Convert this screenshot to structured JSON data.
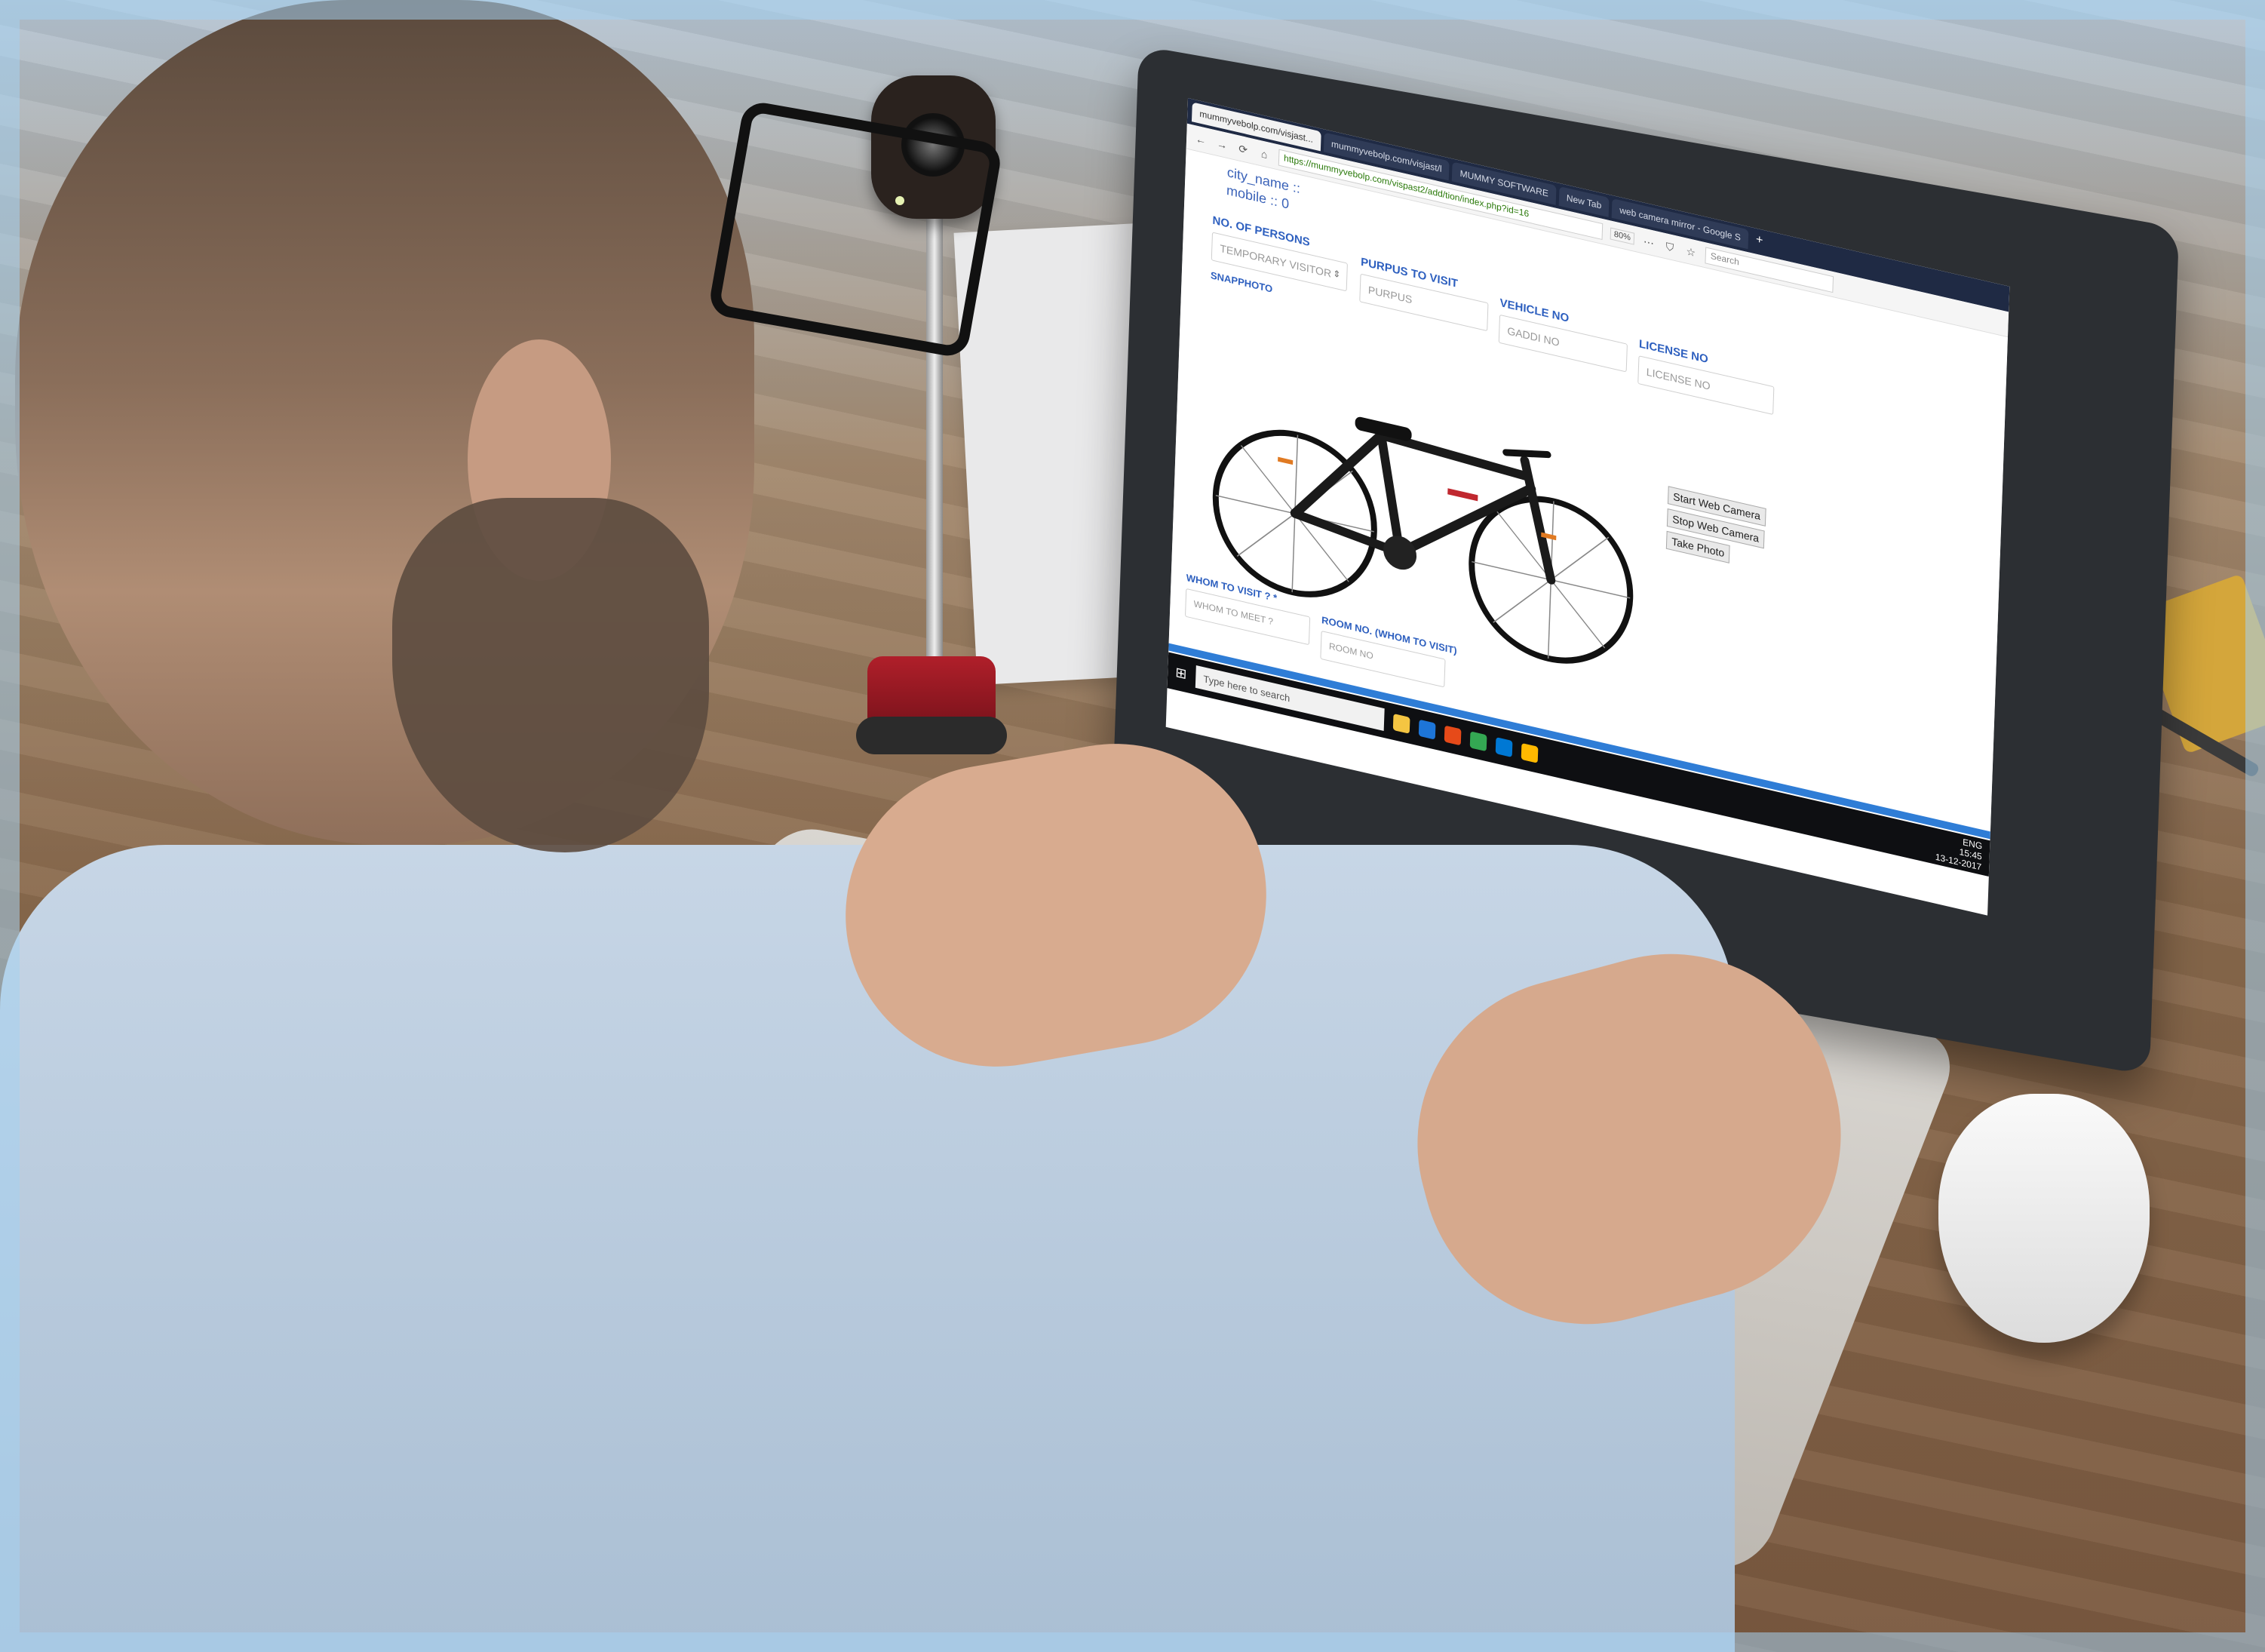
{
  "browser": {
    "tabs": [
      "mummyvebolp.com/visjast...",
      "mummyvebolp.com/visjast/l",
      "MUMMY SOFTWARE",
      "New Tab",
      "web camera mirror - Google S"
    ],
    "tab_add": "+",
    "url": "https://mummyvebolp.com/vispast2/add/tion/index.php?id=16",
    "zoom": "80%",
    "search_placeholder": "Search"
  },
  "form": {
    "prev_fields": [
      "city_name ::",
      "mobile :: 0"
    ],
    "no_of_persons_label": "NO. OF PERSONS",
    "no_of_persons_value": "TEMPORARY VISITOR",
    "purpus_label": "PURPUS TO VISIT",
    "purpus_placeholder": "PURPUS",
    "vehicle_label": "VEHICLE NO",
    "vehicle_placeholder": "GADDI NO",
    "license_label": "LICENSE NO",
    "license_placeholder": "LICENSE NO",
    "snap_label": "SNAPPHOTO",
    "whom_label": "WHOM TO VISIT ? *",
    "whom_placeholder": "WHOM TO MEET ?",
    "room_label": "ROOM NO. (WHOM TO VISIT)",
    "room_placeholder": "ROOM NO",
    "buttons": {
      "start": "Start Web Camera",
      "stop": "Stop Web Camera",
      "take": "Take Photo"
    }
  },
  "taskbar": {
    "search_text": "Type here to search",
    "time": "15:45",
    "date": "13-12-2017",
    "lang": "ENG"
  },
  "colors": {
    "form_label": "#2d5fbf",
    "progress": "#2f7dd6",
    "taskbar": "#0e0f12"
  }
}
